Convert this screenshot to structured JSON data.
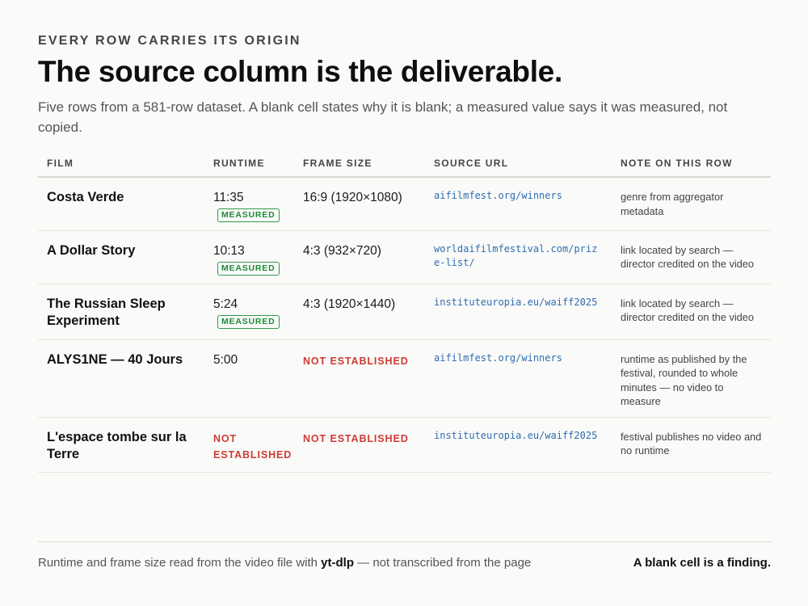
{
  "header": {
    "eyebrow": "EVERY ROW CARRIES ITS ORIGIN",
    "title": "The source column is the deliverable.",
    "subtitle": "Five rows from a 581-row dataset. A blank cell states why it is blank; a measured value says it was measured, not copied."
  },
  "table": {
    "columns": [
      "FILM",
      "RUNTIME",
      "FRAME SIZE",
      "SOURCE URL",
      "NOTE ON THIS ROW"
    ],
    "badge_measured": "MEASURED",
    "rows": [
      {
        "film": "Costa Verde",
        "runtime": "11:35",
        "runtime_status": "MEASURED",
        "frame_size": "16:9 (1920×1080)",
        "source_url": "aifilmfest.org/winners",
        "note": "genre from aggregator metadata"
      },
      {
        "film": "A Dollar Story",
        "runtime": "10:13",
        "runtime_status": "MEASURED",
        "frame_size": "4:3 (932×720)",
        "source_url": "worldaifilmfestival.com/prize-list/",
        "note": "link located by search — director credited on the video"
      },
      {
        "film": "The Russian Sleep Experiment",
        "runtime": "5:24",
        "runtime_status": "MEASURED",
        "frame_size": "4:3 (1920×1440)",
        "source_url": "instituteuropia.eu/waiff2025",
        "note": "link located by search — director credited on the video"
      },
      {
        "film": "ALYS1NE — 40 Jours",
        "runtime": "5:00",
        "runtime_status": "",
        "frame_size": "NOT ESTABLISHED",
        "source_url": "aifilmfest.org/winners",
        "note": "runtime as published by the festival, rounded to whole minutes — no video to measure"
      },
      {
        "film": "L'espace tombe sur la Terre",
        "runtime": "NOT ESTABLISHED",
        "runtime_status": "",
        "frame_size": "NOT ESTABLISHED",
        "source_url": "instituteuropia.eu/waiff2025",
        "note": "festival publishes no video and no runtime"
      }
    ]
  },
  "footer": {
    "left_prefix": "Runtime and frame size read from the video file with ",
    "left_tool": "yt-dlp",
    "left_suffix": " — not transcribed from the page",
    "right": "A blank cell is a finding."
  },
  "colors": {
    "measured": "#1f8a3b",
    "not_established": "#cc3b35",
    "link": "#2f6db5"
  }
}
